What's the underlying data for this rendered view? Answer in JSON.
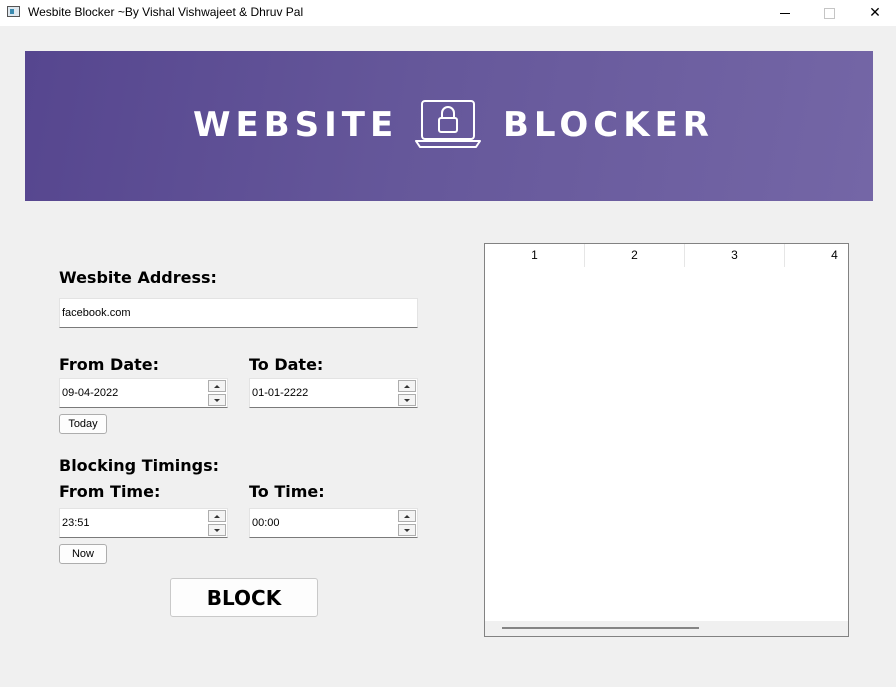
{
  "window": {
    "title": "Wesbite Blocker ~By Vishal Vishwajeet & Dhruv Pal",
    "minimize_icon": "minimize-icon",
    "maximize_icon": "maximize-icon",
    "close_glyph": "✕"
  },
  "banner": {
    "word_left": "WEBSITE",
    "word_right": "BLOCKER",
    "icon": "laptop-lock-icon"
  },
  "form": {
    "website_label": "Wesbite Address:",
    "website_value": "facebook.com",
    "from_date_label": "From Date:",
    "from_date_value": "09-04-2022",
    "to_date_label": "To Date:",
    "to_date_value": "01-01-2222",
    "today_button": "Today",
    "timings_label": "Blocking Timings:",
    "from_time_label": "From Time:",
    "from_time_value": "23:51",
    "to_time_label": "To Time:",
    "to_time_value": "00:00",
    "now_button": "Now",
    "block_button": "BLOCK"
  },
  "table": {
    "columns": [
      "1",
      "2",
      "3",
      "4"
    ]
  }
}
